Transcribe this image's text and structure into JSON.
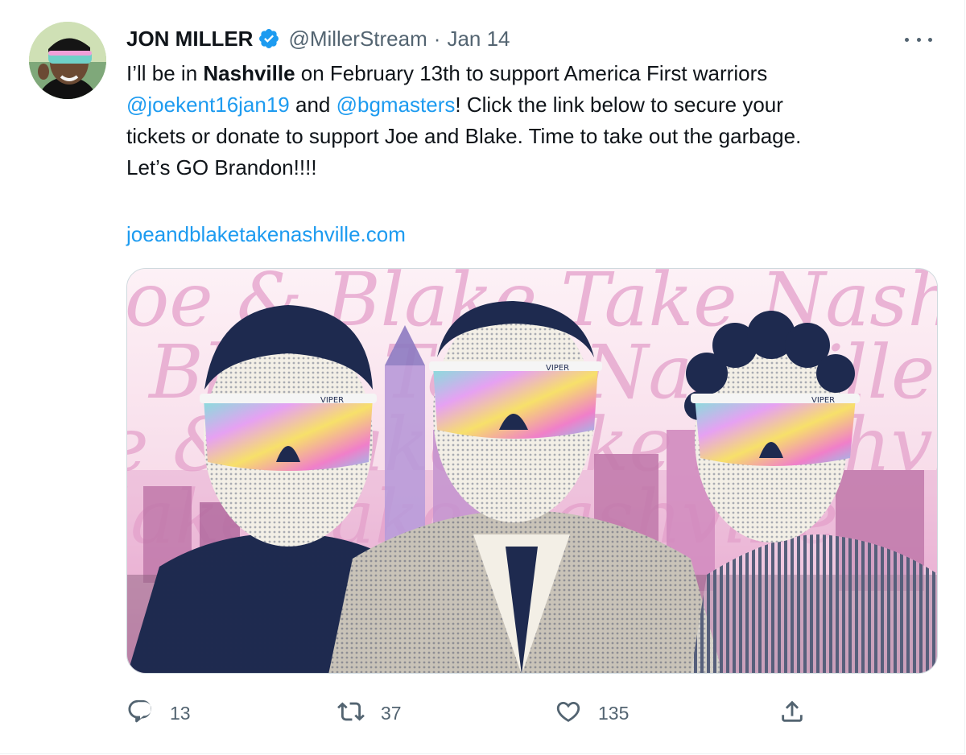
{
  "author": {
    "display_name": "JON MILLER",
    "handle": "@MillerStream",
    "separator": "·",
    "date": "Jan 14"
  },
  "tweet": {
    "line1_pre": "I’ll be in ",
    "line1_bold": "Nashville",
    "line1_post": " on February 13th to support America First warriors",
    "mention1": "@joekent16jan19",
    "line2_mid": " and ",
    "mention2": "@bgmasters",
    "line2_post": "! Click the link below to secure your",
    "line3": "tickets or donate to support Joe and Blake. Time to take out the garbage.",
    "line4": "Let’s GO Brandon!!!!",
    "link": "joeandblaketakenashville.com"
  },
  "media": {
    "background_script_text": "Joe & Blake Take Nashville",
    "brand_text": "VIPER"
  },
  "actions": {
    "reply_count": "13",
    "retweet_count": "37",
    "like_count": "135"
  },
  "colors": {
    "link": "#1d9bf0",
    "secondary_text": "#536471",
    "primary_text": "#0f1419",
    "verified": "#1d9bf0",
    "script_pink": "#e7a9cf",
    "halftone_navy": "#1e2a4f"
  },
  "icons": {
    "verified": "verified-badge-icon",
    "more": "more-dots-icon",
    "reply": "reply-icon",
    "retweet": "retweet-icon",
    "like": "heart-icon",
    "share": "share-icon"
  }
}
